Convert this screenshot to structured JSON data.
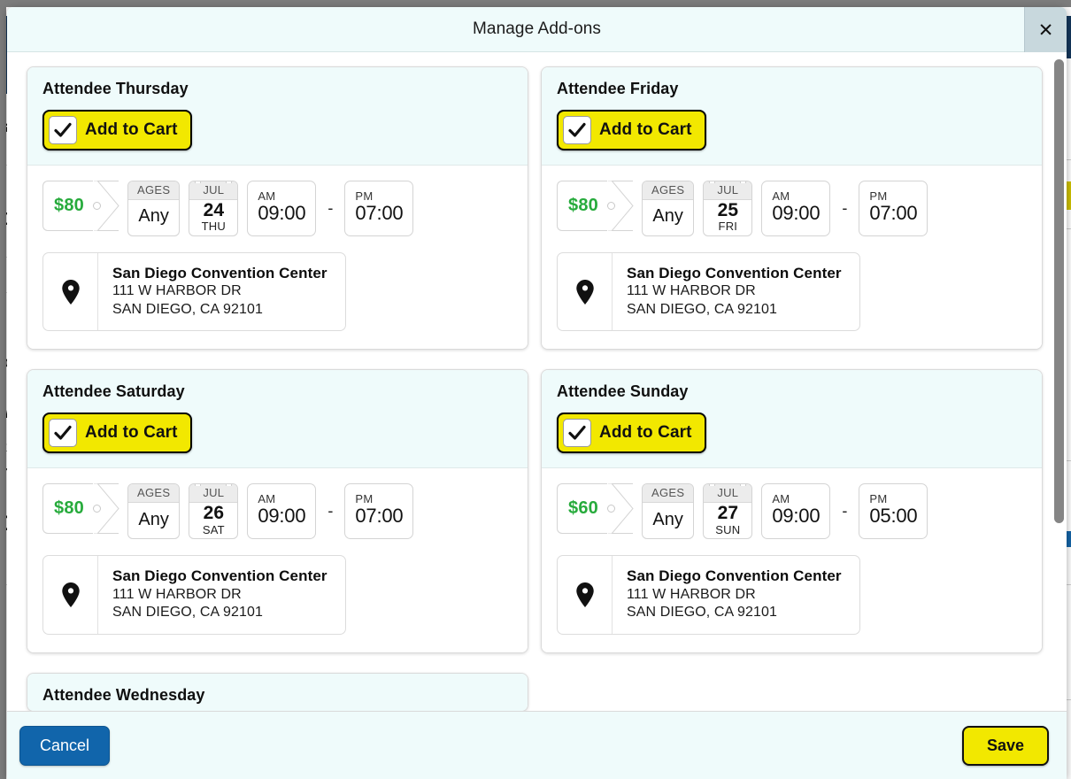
{
  "modal": {
    "title": "Manage Add-ons",
    "close_icon": "close-icon",
    "close_label": "✕"
  },
  "addons": [
    {
      "title": "Attendee Thursday",
      "add_to_cart_label": "Add to Cart",
      "checked": true,
      "price": "$80",
      "ages_label": "AGES",
      "ages_value": "Any",
      "date_month": "JUL",
      "date_day": "24",
      "date_dow": "THU",
      "start_ampm": "AM",
      "start_time": "09:00",
      "dash": "-",
      "end_ampm": "PM",
      "end_time": "07:00",
      "venue_name": "San Diego Convention Center",
      "venue_street": "111 W HARBOR DR",
      "venue_city": "SAN DIEGO, CA 92101"
    },
    {
      "title": "Attendee Friday",
      "add_to_cart_label": "Add to Cart",
      "checked": true,
      "price": "$80",
      "ages_label": "AGES",
      "ages_value": "Any",
      "date_month": "JUL",
      "date_day": "25",
      "date_dow": "FRI",
      "start_ampm": "AM",
      "start_time": "09:00",
      "dash": "-",
      "end_ampm": "PM",
      "end_time": "07:00",
      "venue_name": "San Diego Convention Center",
      "venue_street": "111 W HARBOR DR",
      "venue_city": "SAN DIEGO, CA 92101"
    },
    {
      "title": "Attendee Saturday",
      "add_to_cart_label": "Add to Cart",
      "checked": true,
      "price": "$80",
      "ages_label": "AGES",
      "ages_value": "Any",
      "date_month": "JUL",
      "date_day": "26",
      "date_dow": "SAT",
      "start_ampm": "AM",
      "start_time": "09:00",
      "dash": "-",
      "end_ampm": "PM",
      "end_time": "07:00",
      "venue_name": "San Diego Convention Center",
      "venue_street": "111 W HARBOR DR",
      "venue_city": "SAN DIEGO, CA 92101"
    },
    {
      "title": "Attendee Sunday",
      "add_to_cart_label": "Add to Cart",
      "checked": true,
      "price": "$60",
      "ages_label": "AGES",
      "ages_value": "Any",
      "date_month": "JUL",
      "date_day": "27",
      "date_dow": "SUN",
      "start_ampm": "AM",
      "start_time": "09:00",
      "dash": "-",
      "end_ampm": "PM",
      "end_time": "05:00",
      "venue_name": "San Diego Convention Center",
      "venue_street": "111 W HARBOR DR",
      "venue_city": "SAN DIEGO, CA 92101"
    }
  ],
  "partial_addon": {
    "title": "Attendee Wednesday"
  },
  "footer": {
    "cancel_label": "Cancel",
    "save_label": "Save"
  },
  "colors": {
    "accent_yellow": "#f2e800",
    "cancel_blue": "#1165ab",
    "price_green": "#27ab3c",
    "card_head": "#effbfb"
  }
}
